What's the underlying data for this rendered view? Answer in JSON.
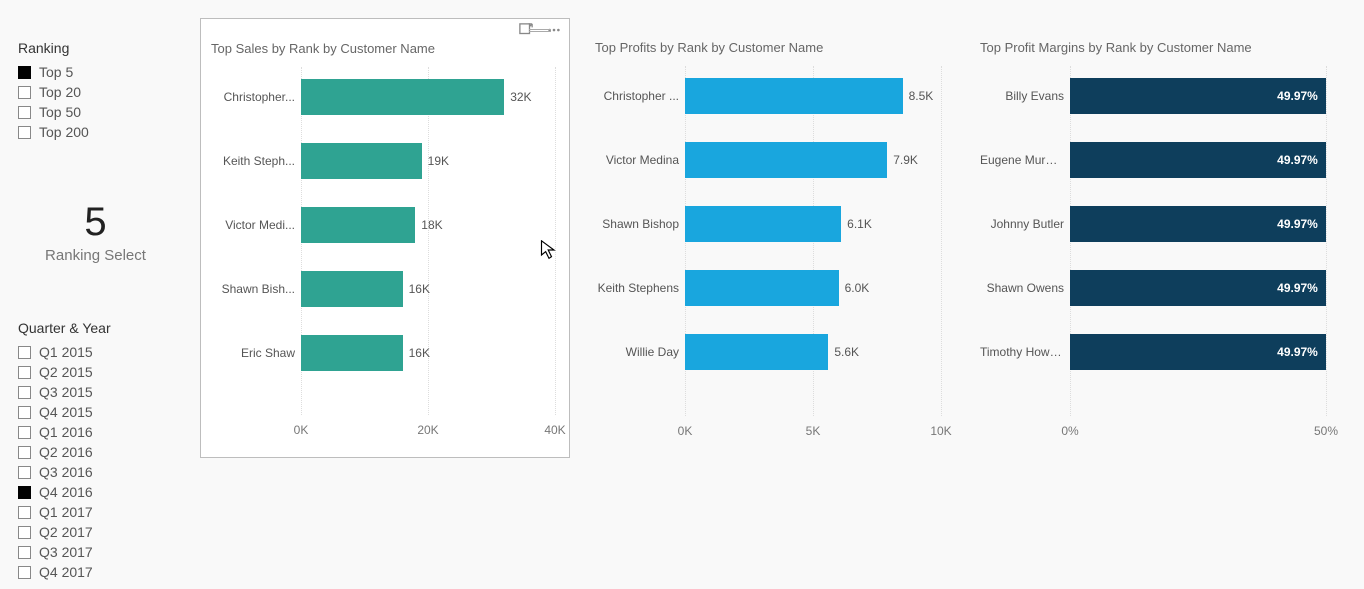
{
  "ranking_slicer": {
    "title": "Ranking",
    "items": [
      {
        "label": "Top 5",
        "selected": true
      },
      {
        "label": "Top 20",
        "selected": false
      },
      {
        "label": "Top 50",
        "selected": false
      },
      {
        "label": "Top 200",
        "selected": false
      }
    ]
  },
  "card": {
    "value": "5",
    "label": "Ranking Select"
  },
  "quarter_slicer": {
    "title": "Quarter & Year",
    "items": [
      {
        "label": "Q1 2015",
        "selected": false
      },
      {
        "label": "Q2 2015",
        "selected": false
      },
      {
        "label": "Q3 2015",
        "selected": false
      },
      {
        "label": "Q4 2015",
        "selected": false
      },
      {
        "label": "Q1 2016",
        "selected": false
      },
      {
        "label": "Q2 2016",
        "selected": false
      },
      {
        "label": "Q3 2016",
        "selected": false
      },
      {
        "label": "Q4 2016",
        "selected": true
      },
      {
        "label": "Q1 2017",
        "selected": false
      },
      {
        "label": "Q2 2017",
        "selected": false
      },
      {
        "label": "Q3 2017",
        "selected": false
      },
      {
        "label": "Q4 2017",
        "selected": false
      }
    ]
  },
  "chart_data": [
    {
      "type": "bar",
      "orientation": "horizontal",
      "title": "Top Sales by Rank by Customer Name",
      "categories": [
        "Christopher...",
        "Keith Steph...",
        "Victor Medi...",
        "Shawn Bish...",
        "Eric Shaw"
      ],
      "values": [
        32000,
        19000,
        18000,
        16000,
        16000
      ],
      "data_labels": [
        "32K",
        "19K",
        "18K",
        "16K",
        "16K"
      ],
      "label_inside": false,
      "color": "#2fa392",
      "xlim": [
        0,
        40000
      ],
      "xticks": [
        0,
        20000,
        40000
      ],
      "xtick_labels": [
        "0K",
        "20K",
        "40K"
      ],
      "selected": true
    },
    {
      "type": "bar",
      "orientation": "horizontal",
      "title": "Top Profits by Rank by Customer Name",
      "categories": [
        "Christopher ...",
        "Victor Medina",
        "Shawn Bishop",
        "Keith Stephens",
        "Willie Day"
      ],
      "values": [
        8500,
        7900,
        6100,
        6000,
        5600
      ],
      "data_labels": [
        "8.5K",
        "7.9K",
        "6.1K",
        "6.0K",
        "5.6K"
      ],
      "label_inside": false,
      "color": "#19a6de",
      "xlim": [
        0,
        10000
      ],
      "xticks": [
        0,
        5000,
        10000
      ],
      "xtick_labels": [
        "0K",
        "5K",
        "10K"
      ],
      "selected": false
    },
    {
      "type": "bar",
      "orientation": "horizontal",
      "title": "Top Profit Margins by Rank by Customer Name",
      "categories": [
        "Billy Evans",
        "Eugene Murphy",
        "Johnny Butler",
        "Shawn Owens",
        "Timothy Howard"
      ],
      "values": [
        49.97,
        49.97,
        49.97,
        49.97,
        49.97
      ],
      "data_labels": [
        "49.97%",
        "49.97%",
        "49.97%",
        "49.97%",
        "49.97%"
      ],
      "label_inside": true,
      "color": "#0e3e5c",
      "xlim": [
        0,
        50
      ],
      "xticks": [
        0,
        50
      ],
      "xtick_labels": [
        "0%",
        "50%"
      ],
      "selected": false
    }
  ]
}
